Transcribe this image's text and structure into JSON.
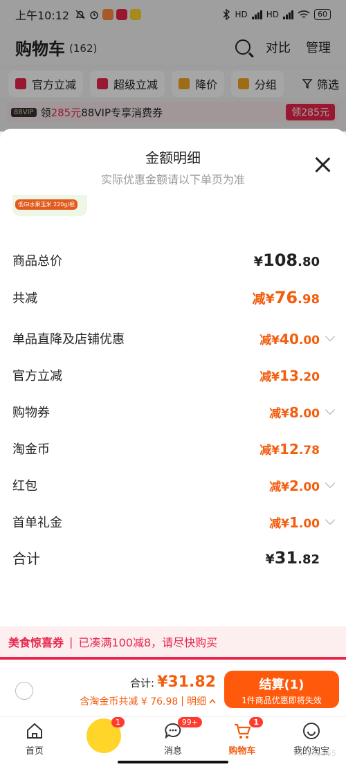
{
  "status_bar": {
    "time": "上午10:12",
    "hd1": "HD",
    "hd2": "HD",
    "battery": "60"
  },
  "header": {
    "title": "购物车",
    "count": "(162)",
    "compare": "对比",
    "manage": "管理"
  },
  "chips": [
    {
      "label": "官方立减",
      "color": "#e8264a"
    },
    {
      "label": "超级立减",
      "color": "#e8264a"
    },
    {
      "label": "降价",
      "color": "#f5a623"
    },
    {
      "label": "分组",
      "color": "#f5a623"
    }
  ],
  "filter_label": "筛选",
  "vip": {
    "tag": "88VIP",
    "prefix": "领",
    "amount": "285元",
    "suffix": "88VIP专享消费券",
    "button": "领285元"
  },
  "sheet": {
    "title": "金额明细",
    "subtitle": "实际优惠金额请以下单页为准",
    "product_tag": "低GI水果玉米 220g/根",
    "rows": [
      {
        "key": "商品总价",
        "prefix": "¥",
        "int": "108",
        "dec": ".80",
        "orange": false,
        "chevron": false
      },
      {
        "key": "共减",
        "prefix": "减¥",
        "int": "76",
        "dec": ".98",
        "orange": true,
        "chevron": false
      },
      {
        "key": "单品直降及店铺优惠",
        "prefix": "减¥",
        "int": "40",
        "dec": ".00",
        "orange": true,
        "chevron": true
      },
      {
        "key": "官方立减",
        "prefix": "减¥",
        "int": "13",
        "dec": ".20",
        "orange": true,
        "chevron": false
      },
      {
        "key": "购物券",
        "prefix": "减¥",
        "int": "8",
        "dec": ".00",
        "orange": true,
        "chevron": true
      },
      {
        "key": "淘金币",
        "prefix": "减¥",
        "int": "12",
        "dec": ".78",
        "orange": true,
        "chevron": false
      },
      {
        "key": "红包",
        "prefix": "减¥",
        "int": "2",
        "dec": ".00",
        "orange": true,
        "chevron": true
      },
      {
        "key": "首单礼金",
        "prefix": "减¥",
        "int": "1",
        "dec": ".00",
        "orange": true,
        "chevron": true
      },
      {
        "key": "合计",
        "prefix": "¥",
        "int": "31",
        "dec": ".82",
        "orange": false,
        "chevron": false
      }
    ]
  },
  "promo": {
    "label": "美食惊喜券",
    "text": "已凑满100减8，请尽快购买"
  },
  "checkout": {
    "sum_label": "合计:",
    "sum_value": "¥31.82",
    "detail": "含淘金币共减 ¥ 76.98",
    "detail_link": "明细",
    "pay_label": "结算(1)",
    "pay_sub": "1件商品优惠即将失效"
  },
  "tabs": [
    {
      "label": "首页",
      "badge": ""
    },
    {
      "label": "",
      "badge": "1"
    },
    {
      "label": "消息",
      "badge": "99+"
    },
    {
      "label": "购物车",
      "badge": "1"
    },
    {
      "label": "我的淘宝",
      "badge": ""
    }
  ],
  "watermark": "lollipop565"
}
